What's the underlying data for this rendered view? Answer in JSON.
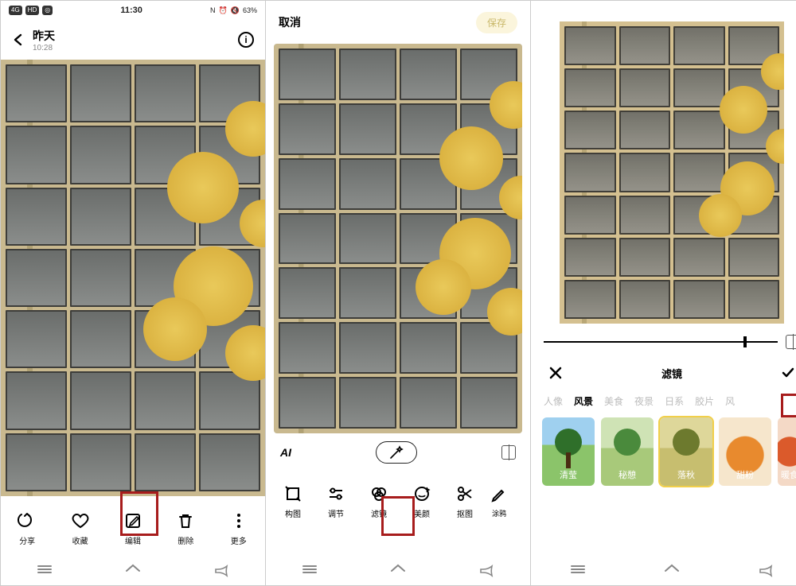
{
  "panel1": {
    "status": {
      "time": "11:30",
      "battery": "63%"
    },
    "header": {
      "title": "昨天",
      "subtitle": "10:28"
    },
    "actions": [
      {
        "name": "share",
        "label": "分享"
      },
      {
        "name": "fav",
        "label": "收藏"
      },
      {
        "name": "edit",
        "label": "编辑"
      },
      {
        "name": "delete",
        "label": "删除"
      },
      {
        "name": "more",
        "label": "更多"
      }
    ]
  },
  "panel2": {
    "header": {
      "cancel": "取消",
      "save": "保存"
    },
    "ai_label": "AI",
    "tools": [
      {
        "name": "compose",
        "label": "构图"
      },
      {
        "name": "adjust",
        "label": "调节"
      },
      {
        "name": "filter",
        "label": "滤镜"
      },
      {
        "name": "beauty",
        "label": "美颜"
      },
      {
        "name": "cutout",
        "label": "抠图"
      },
      {
        "name": "doodle",
        "label": "涂鸦"
      }
    ]
  },
  "panel3": {
    "slider_pct": 86,
    "header": {
      "title": "滤镜"
    },
    "categories": [
      {
        "label": "人像",
        "active": false
      },
      {
        "label": "风景",
        "active": true
      },
      {
        "label": "美食",
        "active": false
      },
      {
        "label": "夜景",
        "active": false
      },
      {
        "label": "日系",
        "active": false
      },
      {
        "label": "胶片",
        "active": false
      },
      {
        "label": "风",
        "active": false
      }
    ],
    "filters": [
      {
        "name": "清莹",
        "selected": false
      },
      {
        "name": "秘憩",
        "selected": false
      },
      {
        "name": "落秋",
        "selected": true
      },
      {
        "name": "甜粉",
        "selected": false
      },
      {
        "name": "暖食",
        "selected": false
      }
    ]
  }
}
